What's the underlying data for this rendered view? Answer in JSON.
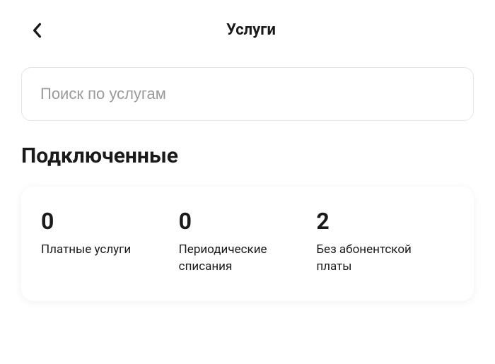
{
  "header": {
    "title": "Услуги"
  },
  "search": {
    "placeholder": "Поиск по услугам"
  },
  "section": {
    "connected_title": "Подключенные"
  },
  "stats": [
    {
      "count": "0",
      "label": "Платные услуги"
    },
    {
      "count": "0",
      "label": "Периодические списания"
    },
    {
      "count": "2",
      "label": "Без абонентской платы"
    }
  ]
}
